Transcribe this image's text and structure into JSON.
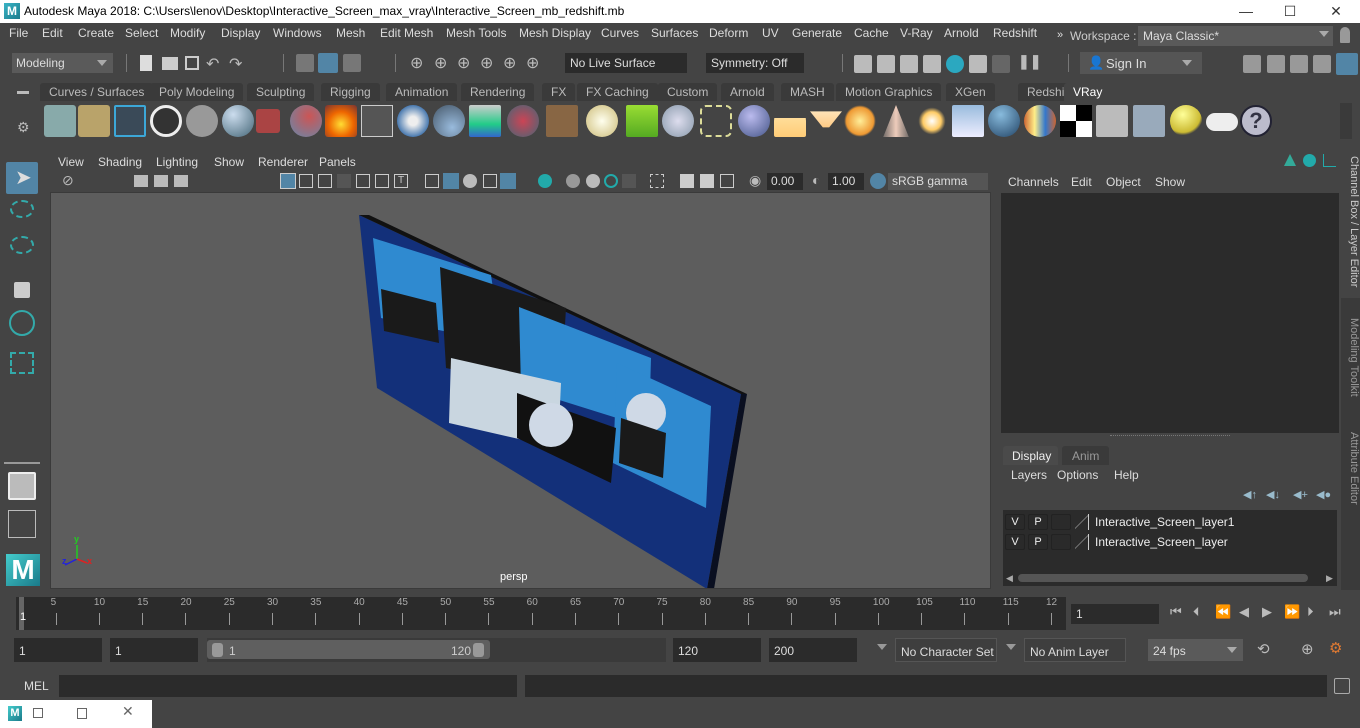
{
  "window": {
    "title": "Autodesk Maya 2018: C:\\Users\\lenov\\Desktop\\Interactive_Screen_max_vray\\Interactive_Screen_mb_redshift.mb",
    "logo": "M",
    "controls": {
      "minimize": "—",
      "maximize": "☐",
      "close": "✕"
    }
  },
  "menubar": {
    "items": [
      "File",
      "Edit",
      "Create",
      "Select",
      "Modify",
      "Display",
      "Windows",
      "Mesh",
      "Edit Mesh",
      "Mesh Tools",
      "Mesh Display",
      "Curves",
      "Surfaces",
      "Deform",
      "UV",
      "Generate",
      "Cache",
      "V-Ray",
      "Arnold",
      "Redshift"
    ],
    "overflow": "»",
    "workspace_label": "Workspace :",
    "workspace_value": "Maya Classic*"
  },
  "toolbar": {
    "mode": "Modeling",
    "live_surface": "No Live Surface",
    "symmetry": "Symmetry: Off",
    "sign_in": "Sign In"
  },
  "shelf": {
    "tabs": [
      "Curves / Surfaces",
      "Poly Modeling",
      "Sculpting",
      "Rigging",
      "Animation",
      "Rendering",
      "FX",
      "FX Caching",
      "Custom",
      "Arnold",
      "MASH",
      "Motion Graphics",
      "XGen",
      "Redshift",
      "VRay"
    ],
    "active_tab": "VRay",
    "icons": [
      "save-scene-icon",
      "open-folder-icon",
      "list-icon",
      "vray-logo-icon",
      "document-icon",
      "sphere-light-icon",
      "camera-icon",
      "spheres-icon",
      "fire-icon",
      "pyramid-icon",
      "cube-icon",
      "cone-icon",
      "light-dome-icon",
      "render-element-icon",
      "texture-icon",
      "globe-icon",
      "grass-icon",
      "fur-icon",
      "curve-icon",
      "geodesic-sphere-icon",
      "half-dome-light-icon",
      "spot-light-icon",
      "sphere-light-glow-icon",
      "ies-light-icon",
      "sun-icon",
      "plane-icon",
      "blue-sphere-icon",
      "material-sphere-icon",
      "checker-icon",
      "frame-buffer-icon",
      "settings-panel-icon",
      "light-lister-icon",
      "cloud-icon",
      "help-icon"
    ]
  },
  "viewport": {
    "menus": [
      "View",
      "Shading",
      "Lighting",
      "Show",
      "Renderer",
      "Panels"
    ],
    "exposure": "0.00",
    "gamma": "1.00",
    "color_space": "sRGB gamma",
    "camera_label": "persp",
    "axis": {
      "x": "x",
      "y": "y",
      "z": "z"
    }
  },
  "channel_box": {
    "menus": [
      "Channels",
      "Edit",
      "Object",
      "Show"
    ]
  },
  "layer_editor": {
    "tabs": [
      "Display",
      "Anim"
    ],
    "active_tab": "Display",
    "menus": [
      "Layers",
      "Options",
      "Help"
    ],
    "layers": [
      {
        "v": "V",
        "p": "P",
        "name": "Interactive_Screen_layer1"
      },
      {
        "v": "V",
        "p": "P",
        "name": "Interactive_Screen_layer"
      }
    ]
  },
  "side_tabs": [
    "Channel Box / Layer Editor",
    "Modeling Toolkit",
    "Attribute Editor"
  ],
  "timeline": {
    "ticks": [
      "5",
      "10",
      "15",
      "20",
      "25",
      "30",
      "35",
      "40",
      "45",
      "50",
      "55",
      "60",
      "65",
      "70",
      "75",
      "80",
      "85",
      "90",
      "95",
      "100",
      "105",
      "110",
      "115",
      "12"
    ],
    "current_frame_marker": "1",
    "current_frame": "1"
  },
  "range": {
    "start": "1",
    "playback_start": "1",
    "slider_start": "1",
    "slider_end": "120",
    "playback_end": "120",
    "end": "200",
    "character_set": "No Character Set",
    "anim_layer": "No Anim Layer",
    "fps": "24 fps"
  },
  "command_line": {
    "label": "MEL",
    "value": ""
  },
  "colors": {
    "accent": "#5285a6",
    "keyframe": "#e07a32",
    "background": "#444444",
    "field": "#2b2b2b",
    "screen_frame": "#1a3a8a",
    "screen_panel": "#2a7ac0"
  }
}
